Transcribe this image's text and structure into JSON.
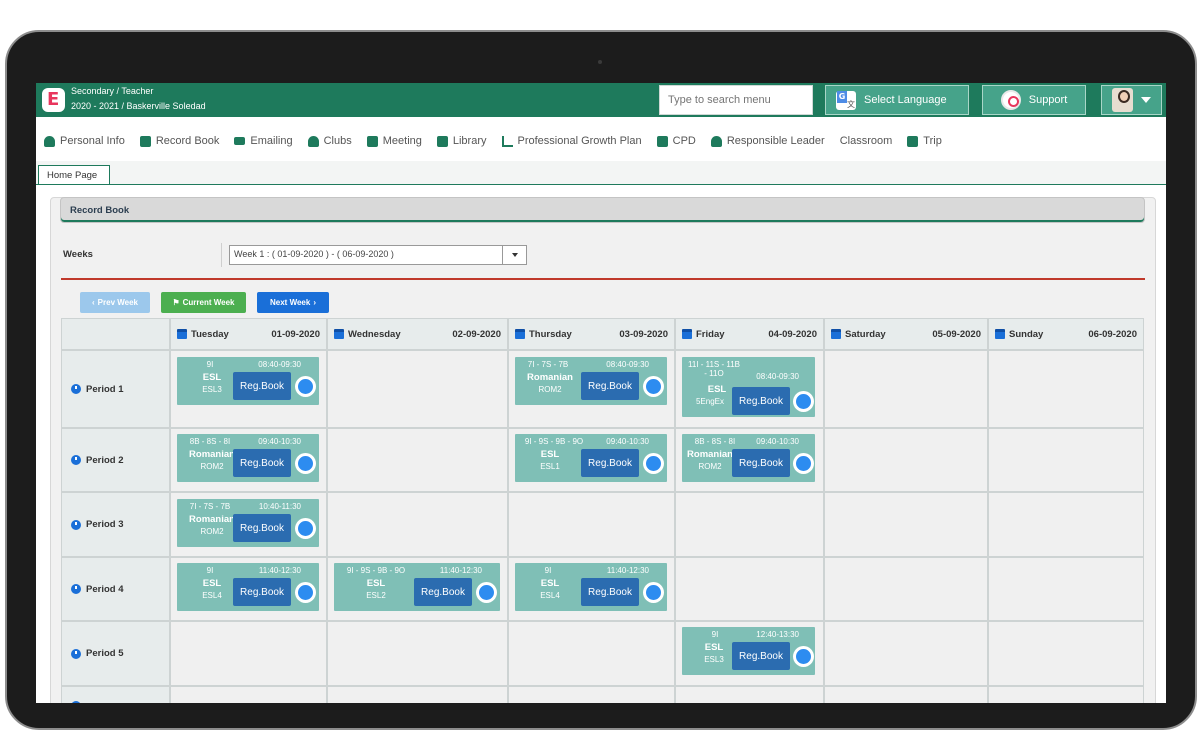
{
  "header": {
    "logo_letter": "E",
    "role": "Secondary / Teacher",
    "year_user": "2020 - 2021 / Baskerville Soledad",
    "search_placeholder": "Type to search menu",
    "select_language": "Select Language",
    "support": "Support"
  },
  "nav": [
    {
      "label": "Personal Info",
      "icon": "person-icon"
    },
    {
      "label": "Record Book",
      "icon": "book-icon"
    },
    {
      "label": "Emailing",
      "icon": "envelope-icon"
    },
    {
      "label": "Clubs",
      "icon": "chess-icon"
    },
    {
      "label": "Meeting",
      "icon": "calendar-check-icon"
    },
    {
      "label": "Library",
      "icon": "book-icon"
    },
    {
      "label": "Professional Growth Plan",
      "icon": "line-chart-icon"
    },
    {
      "label": "CPD",
      "icon": "file-icon"
    },
    {
      "label": "Responsible Leader",
      "icon": "leader-icon"
    },
    {
      "label": "Classroom",
      "icon": "monitor-icon"
    },
    {
      "label": "Trip",
      "icon": "bus-icon"
    }
  ],
  "tabs": {
    "home": "Home Page"
  },
  "panel": {
    "title": "Record Book"
  },
  "weeks": {
    "label": "Weeks",
    "selected": "Week 1 : ( 01-09-2020 ) - ( 06-09-2020 )",
    "prev": "Prev Week",
    "current": "Current Week",
    "next": "Next Week"
  },
  "days": [
    {
      "name": "Tuesday",
      "date": "01-09-2020"
    },
    {
      "name": "Wednesday",
      "date": "02-09-2020"
    },
    {
      "name": "Thursday",
      "date": "03-09-2020"
    },
    {
      "name": "Friday",
      "date": "04-09-2020"
    },
    {
      "name": "Saturday",
      "date": "05-09-2020"
    },
    {
      "name": "Sunday",
      "date": "06-09-2020"
    }
  ],
  "periods": [
    "Period 1",
    "Period 2",
    "Period 3",
    "Period 4",
    "Period 5"
  ],
  "reg_label": "Reg.Book",
  "lessons": {
    "p1_tue": {
      "group": "9I",
      "time": "08:40-09:30",
      "subject": "ESL",
      "room": "ESL3"
    },
    "p1_thu": {
      "group": "7I - 7S - 7B",
      "time": "08:40-09:30",
      "subject": "Romanian",
      "room": "ROM2"
    },
    "p1_fri": {
      "group": "11I - 11S - 11B - 11O",
      "time": "08:40-09:30",
      "subject": "ESL",
      "room": "5EngEx"
    },
    "p2_tue": {
      "group": "8B - 8S - 8I",
      "time": "09:40-10:30",
      "subject": "Romanian",
      "room": "ROM2"
    },
    "p2_thu": {
      "group": "9I - 9S - 9B - 9O",
      "time": "09:40-10:30",
      "subject": "ESL",
      "room": "ESL1"
    },
    "p2_fri": {
      "group": "8B - 8S - 8I",
      "time": "09:40-10:30",
      "subject": "Romanian",
      "room": "ROM2"
    },
    "p3_tue": {
      "group": "7I - 7S - 7B",
      "time": "10:40-11:30",
      "subject": "Romanian",
      "room": "ROM2"
    },
    "p4_tue": {
      "group": "9I",
      "time": "11:40-12:30",
      "subject": "ESL",
      "room": "ESL4"
    },
    "p4_wed": {
      "group": "9I - 9S - 9B - 9O",
      "time": "11:40-12:30",
      "subject": "ESL",
      "room": "ESL2"
    },
    "p4_thu": {
      "group": "9I",
      "time": "11:40-12:30",
      "subject": "ESL",
      "room": "ESL4"
    },
    "p5_fri": {
      "group": "9I",
      "time": "12:40-13:30",
      "subject": "ESL",
      "room": "ESL3"
    }
  },
  "colors": {
    "brand": "#1e7a5c",
    "card": "#7fbfb6",
    "reg_button": "#2b6cb0",
    "accent_red": "#c0392b"
  }
}
